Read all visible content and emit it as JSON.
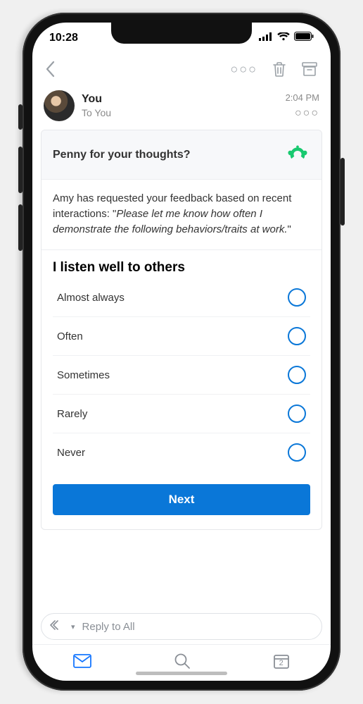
{
  "status": {
    "time": "10:28"
  },
  "sender": {
    "from": "You",
    "to": "To You",
    "time": "2:04 PM"
  },
  "card": {
    "header_title": "Penny for your thoughts?",
    "intro_prefix": "Amy has requested your feedback based on recent interactions: \"",
    "intro_quote": "Please let me know how often I demonstrate the following behaviors/traits at work.",
    "intro_suffix": "\"",
    "question": "I listen well to others",
    "options": [
      "Almost always",
      "Often",
      "Sometimes",
      "Rarely",
      "Never"
    ],
    "next_label": "Next"
  },
  "reply": {
    "placeholder": "Reply to All"
  },
  "tabs": {
    "calendar_badge": "2"
  },
  "colors": {
    "accent": "#0a77d8",
    "brand_green": "#18c96f"
  }
}
